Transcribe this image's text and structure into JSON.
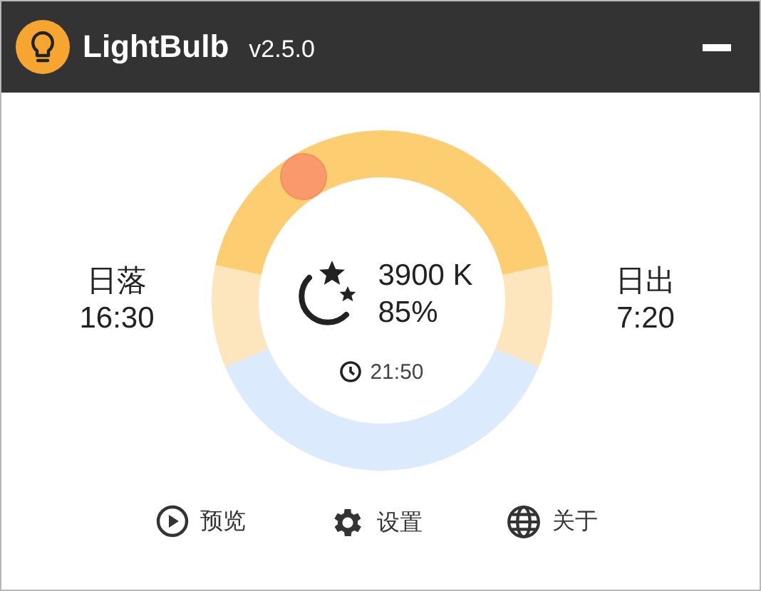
{
  "window": {
    "title": "LightBulb",
    "version": "v2.5.0"
  },
  "sunset": {
    "label": "日落",
    "time": "16:30"
  },
  "sunrise": {
    "label": "日出",
    "time": "7:20"
  },
  "status": {
    "temperature": "3900 K",
    "brightness": "85%",
    "time": "21:50"
  },
  "buttons": [
    {
      "kind": "preview",
      "label": "预览"
    },
    {
      "kind": "settings",
      "label": "设置"
    },
    {
      "kind": "about",
      "label": "关于"
    }
  ]
}
